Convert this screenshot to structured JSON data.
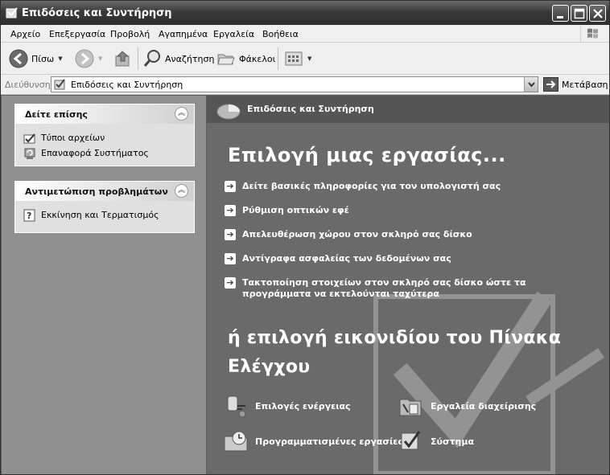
{
  "window": {
    "title": "Επιδόσεις και Συντήρηση"
  },
  "menu": [
    "Αρχείο",
    "Επεξεργασία",
    "Προβολή",
    "Αγαπημένα",
    "Εργαλεία",
    "Βοήθεια"
  ],
  "toolbar": {
    "back": "Πίσω",
    "search": "Αναζήτηση",
    "folders": "Φάκελοι"
  },
  "address": {
    "label": "Διεύθυνση",
    "value": "Επιδόσεις και Συντήρηση",
    "go": "Μετάβαση"
  },
  "sidebar": {
    "see_also": {
      "title": "Δείτε επίσης",
      "items": [
        {
          "label": "Τύποι αρχείων",
          "icon": "file-types-icon"
        },
        {
          "label": "Επαναφορά Συστήματος",
          "icon": "system-restore-icon"
        }
      ]
    },
    "troubleshoot": {
      "title": "Αντιμετώπιση προβλημάτων",
      "items": [
        {
          "label": "Εκκίνηση και Τερματισμός",
          "icon": "help-icon"
        }
      ]
    }
  },
  "main": {
    "header": "Επιδόσεις και Συντήρηση",
    "pick_task": "Επιλογή μιας εργασίας...",
    "tasks": [
      "Δείτε βασικές πληροφορίες για τον υπολογιστή σας",
      "Ρύθμιση οπτικών εφέ",
      "Απελευθέρωση χώρου στον σκληρό σας δίσκο",
      "Αντίγραφα ασφαλείας των δεδομένων σας",
      "Τακτοποίηση στοιχείων στον σκληρό σας δίσκο ώστε τα προγράμματα να εκτελούνται ταχύτερα"
    ],
    "pick_icon": "ή επιλογή εικονιδίου του Πίνακα Ελέγχου",
    "icons": [
      {
        "label": "Επιλογές ενέργειας",
        "icon": "power-options-icon"
      },
      {
        "label": "Εργαλεία διαχείρισης",
        "icon": "admin-tools-icon"
      },
      {
        "label": "Προγραμματισμένες εργασίες",
        "icon": "scheduled-tasks-icon"
      },
      {
        "label": "Σύστημα",
        "icon": "system-icon"
      }
    ]
  }
}
